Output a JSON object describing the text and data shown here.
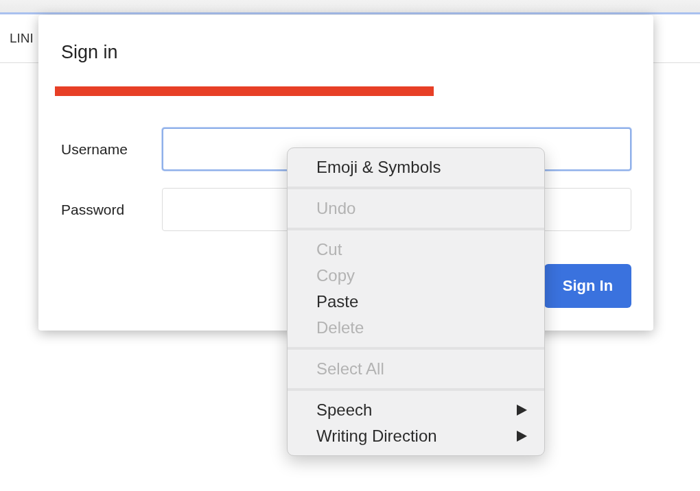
{
  "background_page": {
    "tab_label": "LINI"
  },
  "dialog": {
    "title": "Sign in",
    "address_redacted": true,
    "fields": [
      {
        "label": "Username",
        "focused": true
      },
      {
        "label": "Password",
        "focused": false
      }
    ],
    "submit_button": "Sign In"
  },
  "context_menu": {
    "groups": [
      {
        "items": [
          {
            "label": "Emoji & Symbols",
            "disabled": false,
            "submenu": false
          }
        ]
      },
      {
        "items": [
          {
            "label": "Undo",
            "disabled": true,
            "submenu": false
          }
        ]
      },
      {
        "items": [
          {
            "label": "Cut",
            "disabled": true,
            "submenu": false
          },
          {
            "label": "Copy",
            "disabled": true,
            "submenu": false
          },
          {
            "label": "Paste",
            "disabled": false,
            "submenu": false
          },
          {
            "label": "Delete",
            "disabled": true,
            "submenu": false
          }
        ]
      },
      {
        "items": [
          {
            "label": "Select All",
            "disabled": true,
            "submenu": false
          }
        ]
      },
      {
        "items": [
          {
            "label": "Speech",
            "disabled": false,
            "submenu": true
          },
          {
            "label": "Writing Direction",
            "disabled": false,
            "submenu": true
          }
        ]
      }
    ]
  }
}
